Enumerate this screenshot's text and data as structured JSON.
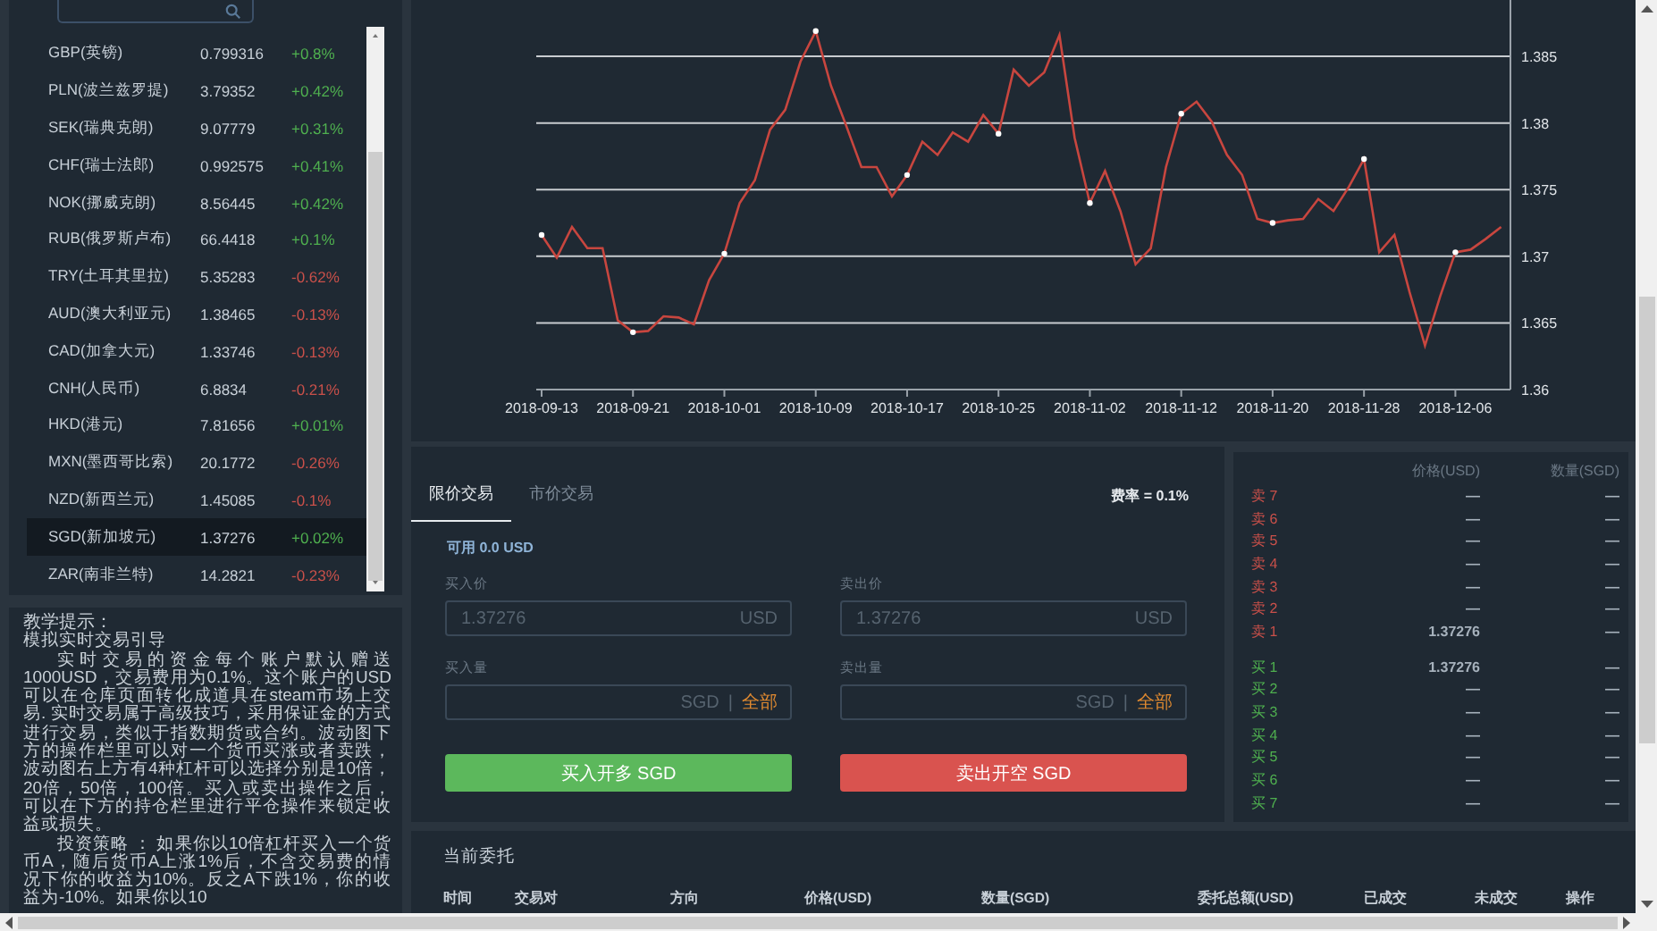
{
  "currencies": [
    {
      "name": "GBP(英镑)",
      "price": "0.799316",
      "change": "+0.8%",
      "color": "#4fb04f",
      "selected": false
    },
    {
      "name": "PLN(波兰兹罗提)",
      "price": "3.79352",
      "change": "+0.42%",
      "color": "#4fb04f",
      "selected": false
    },
    {
      "name": "SEK(瑞典克朗)",
      "price": "9.07779",
      "change": "+0.31%",
      "color": "#4fb04f",
      "selected": false
    },
    {
      "name": "CHF(瑞士法郎)",
      "price": "0.992575",
      "change": "+0.41%",
      "color": "#4fb04f",
      "selected": false
    },
    {
      "name": "NOK(挪威克朗)",
      "price": "8.56445",
      "change": "+0.42%",
      "color": "#4fb04f",
      "selected": false
    },
    {
      "name": "RUB(俄罗斯卢布)",
      "price": "66.4418",
      "change": "+0.1%",
      "color": "#4fb04f",
      "selected": false
    },
    {
      "name": "TRY(土耳其里拉)",
      "price": "5.35283",
      "change": "-0.62%",
      "color": "#c9504a",
      "selected": false
    },
    {
      "name": "AUD(澳大利亚元)",
      "price": "1.38465",
      "change": "-0.13%",
      "color": "#c9504a",
      "selected": false
    },
    {
      "name": "CAD(加拿大元)",
      "price": "1.33746",
      "change": "-0.13%",
      "color": "#c9504a",
      "selected": false
    },
    {
      "name": "CNH(人民币)",
      "price": "6.8834",
      "change": "-0.21%",
      "color": "#c9504a",
      "selected": false
    },
    {
      "name": "HKD(港元)",
      "price": "7.81656",
      "change": "+0.01%",
      "color": "#4fb04f",
      "selected": false
    },
    {
      "name": "MXN(墨西哥比索)",
      "price": "20.1772",
      "change": "-0.26%",
      "color": "#c9504a",
      "selected": false
    },
    {
      "name": "NZD(新西兰元)",
      "price": "1.45085",
      "change": "-0.1%",
      "color": "#c9504a",
      "selected": false
    },
    {
      "name": "SGD(新加坡元)",
      "price": "1.37276",
      "change": "+0.02%",
      "color": "#4fb04f",
      "selected": true
    },
    {
      "name": "ZAR(南非兰特)",
      "price": "14.2821",
      "change": "-0.23%",
      "color": "#c9504a",
      "selected": false
    }
  ],
  "tutorial": {
    "title": "教学提示：",
    "subtitle": "模拟实时交易引导",
    "paragraphs": [
      "实时交易的资金每个账户默认赠送1000USD，交易费用为0.1%。这个账户的USD可以在仓库页面转化成道具在steam市场上交易. 实时交易属于高级技巧，采用保证金的方式进行交易，类似于指数期货或合约。波动图下方的操作栏里可以对一个货币买涨或者卖跌，波动图右上方有4种杠杆可以选择分别是10倍，20倍，50倍，100倍。买入或卖出操作之后，可以在下方的持仓栏里进行平仓操作来锁定收益或损失。",
      "投资策略 ： 如果你以10倍杠杆买入一个货币A，随后货币A上涨1%后，不含交易费的情况下你的收益为10%。反之A下跌1%，你的收益为-10%。如果你以10"
    ]
  },
  "chart": {
    "chart_data": {
      "type": "line",
      "grid": true,
      "categories": [
        "2018-09-13",
        null,
        null,
        null,
        null,
        null,
        "2018-09-21",
        null,
        null,
        null,
        null,
        null,
        "2018-10-01",
        null,
        null,
        null,
        null,
        null,
        "2018-10-09",
        null,
        null,
        null,
        null,
        null,
        "2018-10-17",
        null,
        null,
        null,
        null,
        null,
        "2018-10-25",
        null,
        null,
        null,
        null,
        null,
        "2018-11-02",
        null,
        null,
        null,
        null,
        null,
        "2018-11-12",
        null,
        null,
        null,
        null,
        null,
        "2018-11-20",
        null,
        null,
        null,
        null,
        null,
        "2018-11-28",
        null,
        null,
        null,
        null,
        null,
        "2018-12-06",
        null,
        null,
        null
      ],
      "series": [
        {
          "color": "#c8463f",
          "values": [
            1.3716,
            1.3699,
            1.3722,
            1.3706,
            1.3706,
            1.3652,
            1.3643,
            1.3644,
            1.3655,
            1.3654,
            1.3649,
            1.3682,
            1.3702,
            1.374,
            1.3757,
            1.3795,
            1.381,
            1.3846,
            1.3869,
            1.3828,
            1.3798,
            1.3767,
            1.3767,
            1.3745,
            1.3761,
            1.3786,
            1.3776,
            1.3793,
            1.3786,
            1.3806,
            1.3792,
            1.384,
            1.3828,
            1.3838,
            1.3866,
            1.3789,
            1.374,
            1.3764,
            1.3734,
            1.3694,
            1.3706,
            1.3767,
            1.3807,
            1.3816,
            1.3801,
            1.3776,
            1.3761,
            1.3728,
            1.3725,
            1.3727,
            1.3728,
            1.3743,
            1.3734,
            1.3752,
            1.3773,
            1.3703,
            1.3716,
            1.3673,
            1.3633,
            1.367,
            1.3703,
            1.3705,
            1.3713,
            1.3722
          ]
        }
      ],
      "yticks": [
        {
          "value": 1.36,
          "label": "1.36"
        },
        {
          "value": 1.365,
          "label": "1.365"
        },
        {
          "value": 1.37,
          "label": "1.37"
        },
        {
          "value": 1.375,
          "label": "1.375"
        },
        {
          "value": 1.38,
          "label": "1.38"
        },
        {
          "value": 1.385,
          "label": "1.385"
        }
      ],
      "ylim": [
        1.36,
        1.3895
      ]
    }
  },
  "trade_form": {
    "tabs": [
      {
        "label": "限价交易",
        "selected": true
      },
      {
        "label": "市价交易",
        "selected": false
      }
    ],
    "fee": "费率 = 0.1%",
    "available": "可用 0.0 USD",
    "sides": [
      {
        "kind": "buy",
        "price_label": "买入价",
        "price_placeholder": "1.37276",
        "price_unit": "USD",
        "amount_label": "买入量",
        "amount_unit": "SGD",
        "separator": "|",
        "all_link": "全部",
        "button": "买入开多 SGD"
      },
      {
        "kind": "sell",
        "price_label": "卖出价",
        "price_placeholder": "1.37276",
        "price_unit": "USD",
        "amount_label": "卖出量",
        "amount_unit": "SGD",
        "separator": "|",
        "all_link": "全部",
        "button": "卖出开空 SGD"
      }
    ]
  },
  "order_book": {
    "columns": [
      "价格(USD)",
      "数量(SGD)"
    ],
    "asks": [
      {
        "label": "卖 7",
        "price": "—",
        "amount": "—"
      },
      {
        "label": "卖 6",
        "price": "—",
        "amount": "—"
      },
      {
        "label": "卖 5",
        "price": "—",
        "amount": "—"
      },
      {
        "label": "卖 4",
        "price": "—",
        "amount": "—"
      },
      {
        "label": "卖 3",
        "price": "—",
        "amount": "—"
      },
      {
        "label": "卖 2",
        "price": "—",
        "amount": "—"
      },
      {
        "label": "卖 1",
        "price": "1.37276",
        "amount": "—"
      }
    ],
    "bids": [
      {
        "label": "买 1",
        "price": "1.37276",
        "amount": "—"
      },
      {
        "label": "买 2",
        "price": "—",
        "amount": "—"
      },
      {
        "label": "买 3",
        "price": "—",
        "amount": "—"
      },
      {
        "label": "买 4",
        "price": "—",
        "amount": "—"
      },
      {
        "label": "买 5",
        "price": "—",
        "amount": "—"
      },
      {
        "label": "买 6",
        "price": "—",
        "amount": "—"
      },
      {
        "label": "买 7",
        "price": "—",
        "amount": "—"
      }
    ]
  },
  "orders": {
    "title": "当前委托",
    "columns": [
      "时间",
      "交易对",
      "方向",
      "价格(USD)",
      "数量(SGD)",
      "委托总额(USD)",
      "已成交",
      "未成交",
      "操作"
    ]
  }
}
